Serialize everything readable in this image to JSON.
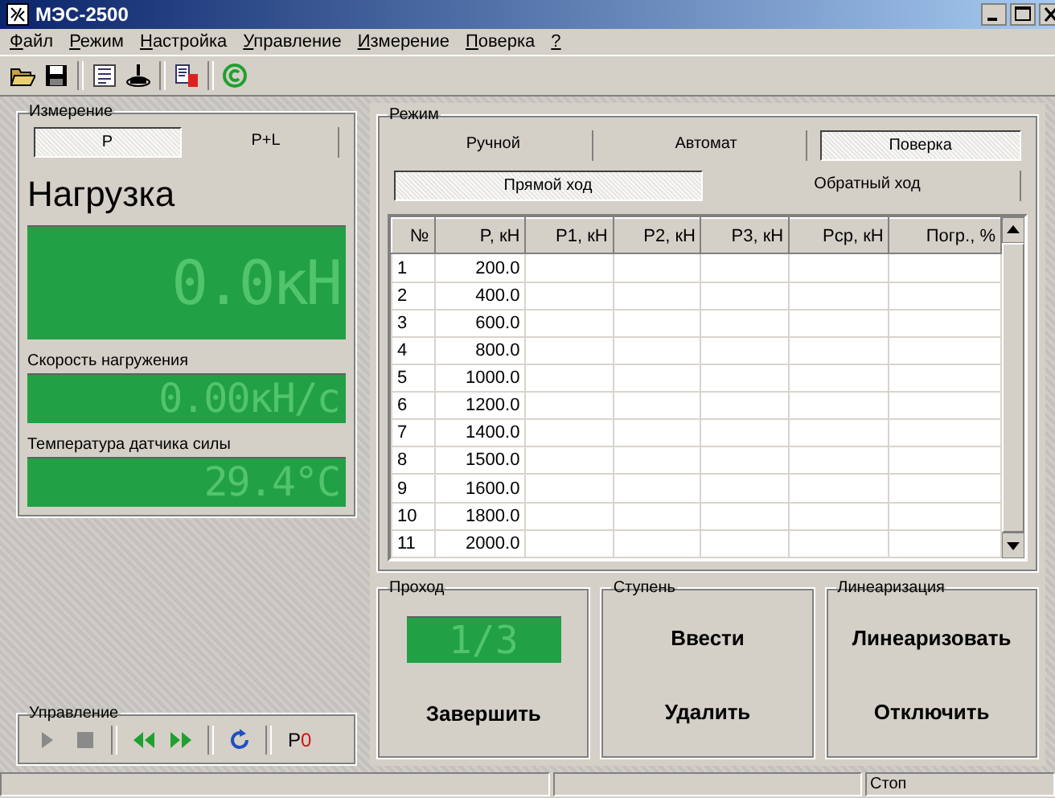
{
  "window": {
    "title": "МЭС-2500"
  },
  "menu": [
    {
      "label": "Файл"
    },
    {
      "label": "Режим"
    },
    {
      "label": "Настройка"
    },
    {
      "label": "Управление"
    },
    {
      "label": "Измерение"
    },
    {
      "label": "Поверка"
    },
    {
      "label": "?"
    }
  ],
  "toolbar": [
    {
      "kind": "open"
    },
    {
      "kind": "save"
    },
    {
      "kind": "separator"
    },
    {
      "kind": "list"
    },
    {
      "kind": "flask"
    },
    {
      "kind": "separator"
    },
    {
      "kind": "document"
    },
    {
      "kind": "separator"
    },
    {
      "kind": "copyright"
    }
  ],
  "measurement": {
    "title": "Измерение",
    "tabs": [
      {
        "label": "P",
        "selected": true
      },
      {
        "label": "P+L",
        "selected": false
      }
    ],
    "heading": "Нагрузка",
    "readouts": [
      {
        "kind": "large",
        "value": "0.0кН"
      },
      {
        "kind": "small",
        "label": "Скорость нагружения",
        "value": "0.00кН/с"
      },
      {
        "kind": "small",
        "label": "Температура датчика силы",
        "value": "29.4°C"
      }
    ]
  },
  "control": {
    "title": "Управление",
    "buttons": [
      {
        "kind": "play"
      },
      {
        "kind": "stop"
      },
      {
        "kind": "separator"
      },
      {
        "kind": "rewind"
      },
      {
        "kind": "forward"
      },
      {
        "kind": "separator"
      },
      {
        "kind": "refresh"
      },
      {
        "kind": "separator"
      },
      {
        "kind": "text",
        "parts": [
          "P",
          "0"
        ]
      }
    ]
  },
  "mode": {
    "title": "Режим",
    "tabs": [
      {
        "label": "Ручной",
        "selected": false
      },
      {
        "label": "Автомат",
        "selected": false
      },
      {
        "label": "Поверка",
        "selected": true
      }
    ],
    "direction_tabs": [
      {
        "label": "Прямой ход",
        "selected": true
      },
      {
        "label": "Обратный ход",
        "selected": false
      }
    ],
    "table": {
      "columns": [
        "№",
        "P, кН",
        "P1, кН",
        "P2, кН",
        "P3, кН",
        "Pср, кН",
        "Погр., %"
      ],
      "rows": [
        [
          "1",
          "200.0"
        ],
        [
          "2",
          "400.0"
        ],
        [
          "3",
          "600.0"
        ],
        [
          "4",
          "800.0"
        ],
        [
          "5",
          "1000.0"
        ],
        [
          "6",
          "1200.0"
        ],
        [
          "7",
          "1400.0"
        ],
        [
          "8",
          "1500.0"
        ],
        [
          "9",
          "1600.0"
        ],
        [
          "10",
          "1800.0"
        ],
        [
          "11",
          "2000.0"
        ]
      ]
    }
  },
  "groups": [
    {
      "title": "Проход",
      "display": "1/3",
      "buttons": [
        "Завершить"
      ]
    },
    {
      "title": "Ступень",
      "buttons": [
        "Ввести",
        "Удалить"
      ]
    },
    {
      "title": "Линеаризация",
      "buttons": [
        "Линеаризовать",
        "Отключить"
      ]
    }
  ],
  "status_bar": {
    "text": "Стоп"
  }
}
